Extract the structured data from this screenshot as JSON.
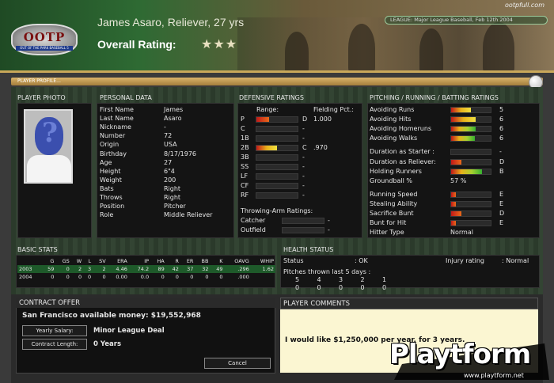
{
  "header": {
    "url_text": "ootpfull.com",
    "player_title": "James Asaro, Reliever, 27 yrs",
    "overall_label": "Overall Rating:",
    "stars": "★★★",
    "league_text": "LEAGUE: Major League Baseball, Feb 12th 2004",
    "logo_text": "OOTP",
    "logo_sub": "OUT OF THE PARK BASEBALL 5"
  },
  "profile_bar": {
    "label": "PLAYER PROFILE..."
  },
  "photo": {
    "title": "PLAYER PHOTO"
  },
  "personal": {
    "title": "PERSONAL DATA",
    "rows": [
      {
        "label": "First Name",
        "value": "James"
      },
      {
        "label": "Last Name",
        "value": "Asaro"
      },
      {
        "label": "Nickname",
        "value": "-"
      },
      {
        "label": "Number",
        "value": "72"
      },
      {
        "label": "Origin",
        "value": "USA"
      },
      {
        "label": "Birthday",
        "value": "8/17/1976"
      },
      {
        "label": "Age",
        "value": "27"
      },
      {
        "label": "Height",
        "value": "6\"4"
      },
      {
        "label": "Weight",
        "value": "200"
      },
      {
        "label": "Bats",
        "value": "Right"
      },
      {
        "label": "Throws",
        "value": "Right"
      },
      {
        "label": "Position",
        "value": "Pitcher"
      },
      {
        "label": "Role",
        "value": "Middle Reliever"
      }
    ]
  },
  "defensive": {
    "title": "DEFENSIVE RATINGS",
    "range_header": "Range:",
    "fielding_header": "Fielding Pct.:",
    "rows": [
      {
        "pos": "P",
        "grade": "D",
        "pct": "1.000",
        "fill": 0.3,
        "kind": "red"
      },
      {
        "pos": "C",
        "grade": "-",
        "pct": "",
        "fill": 0,
        "kind": "red"
      },
      {
        "pos": "1B",
        "grade": "-",
        "pct": "",
        "fill": 0,
        "kind": "red"
      },
      {
        "pos": "2B",
        "grade": "C",
        "pct": ".970",
        "fill": 0.5,
        "kind": "yellow"
      },
      {
        "pos": "3B",
        "grade": "-",
        "pct": "",
        "fill": 0,
        "kind": "red"
      },
      {
        "pos": "SS",
        "grade": "-",
        "pct": "",
        "fill": 0,
        "kind": "red"
      },
      {
        "pos": "LF",
        "grade": "-",
        "pct": "",
        "fill": 0,
        "kind": "red"
      },
      {
        "pos": "CF",
        "grade": "-",
        "pct": "",
        "fill": 0,
        "kind": "red"
      },
      {
        "pos": "RF",
        "grade": "-",
        "pct": "",
        "fill": 0,
        "kind": "red"
      }
    ],
    "arm_title": "Throwing-Arm Ratings:",
    "arm_rows": [
      {
        "label": "Catcher",
        "value": "-"
      },
      {
        "label": "Outfield",
        "value": "-"
      }
    ]
  },
  "pitching": {
    "title": "PITCHING / RUNNING / BATTING RATINGS",
    "rows": [
      {
        "label": "Avoiding Runs",
        "value": "5",
        "fill": 0.5,
        "kind": "yellow",
        "group": 0
      },
      {
        "label": "Avoiding Hits",
        "value": "6",
        "fill": 0.62,
        "kind": "yellow",
        "group": 0
      },
      {
        "label": "Avoiding Homeruns",
        "value": "6",
        "fill": 0.62,
        "kind": "green",
        "group": 0
      },
      {
        "label": "Avoiding Walks",
        "value": "6",
        "fill": 0.6,
        "kind": "green",
        "group": 0
      },
      {
        "label": "Duration as Starter :",
        "value": "-",
        "fill": 0,
        "kind": "red",
        "group": 1
      },
      {
        "label": "Duration as Reliever:",
        "value": "D",
        "fill": 0.25,
        "kind": "red",
        "group": 1
      },
      {
        "label": "Holding Runners",
        "value": "B",
        "fill": 0.78,
        "kind": "green",
        "group": 1
      },
      {
        "label": "Groundball %",
        "value": "57 %",
        "fill": null,
        "kind": "none",
        "group": 1
      },
      {
        "label": "Running Speed",
        "value": "E",
        "fill": 0.12,
        "kind": "red",
        "group": 2
      },
      {
        "label": "Stealing Ability",
        "value": "E",
        "fill": 0.12,
        "kind": "red",
        "group": 2
      },
      {
        "label": "Sacrifice Bunt",
        "value": "D",
        "fill": 0.25,
        "kind": "red",
        "group": 2
      },
      {
        "label": "Bunt for Hit",
        "value": "E",
        "fill": 0.12,
        "kind": "red",
        "group": 2
      },
      {
        "label": "Hitter Type",
        "value": "Normal",
        "fill": null,
        "kind": "none",
        "group": 2
      }
    ]
  },
  "basic_stats": {
    "title": "BASIC STATS",
    "headers": [
      "",
      "G",
      "GS",
      "W",
      "L",
      "SV",
      "ERA",
      "IP",
      "HA",
      "R",
      "ER",
      "BB",
      "K",
      "OAVG",
      "WHIP"
    ],
    "rows": [
      [
        "2003",
        "59",
        "0",
        "2",
        "3",
        "2",
        "4.46",
        "74.2",
        "89",
        "42",
        "37",
        "32",
        "49",
        ".296",
        "1.62"
      ],
      [
        "2004",
        "0",
        "0",
        "0",
        "0",
        "0",
        "0.00",
        "0.0",
        "0",
        "0",
        "0",
        "0",
        "0",
        ".000",
        ""
      ]
    ]
  },
  "health": {
    "title": "HEALTH STATUS",
    "status_label": "Status",
    "status_value": ": OK",
    "injury_label": "Injury rating",
    "injury_value": ": Normal",
    "pitches_label": "Pitches thrown last 5 days :",
    "days": [
      "5",
      "4",
      "3",
      "2",
      "1"
    ],
    "counts": [
      "0",
      "0",
      "0",
      "0",
      "0"
    ]
  },
  "contract": {
    "title": "CONTRACT OFFER",
    "money_text": "San Francisco available money:  $19,552,968",
    "salary_label": "Yearly Salary:",
    "salary_value": "Minor League Deal",
    "length_label": "Contract Length:",
    "length_value": "0 Years",
    "cancel_label": "Cancel"
  },
  "comments": {
    "title": "PLAYER COMMENTS",
    "text": "I would like $1,250,000 per year, for 3 years."
  },
  "watermark": {
    "brand": "Playtform",
    "url": "www.playtform.net"
  }
}
